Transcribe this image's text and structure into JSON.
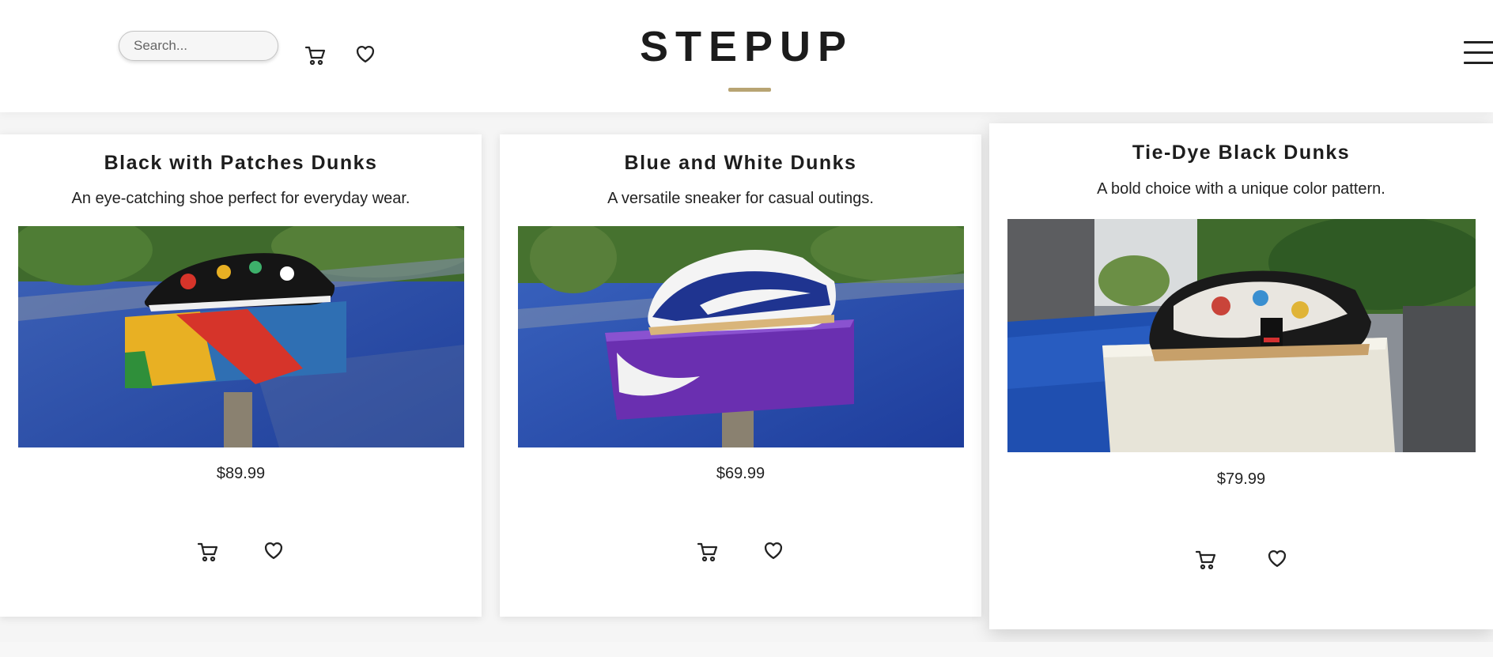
{
  "header": {
    "search_placeholder": "Search...",
    "logo": "STEPUP",
    "accent_color": "#b8a473",
    "icons": [
      "cart-icon",
      "heart-icon",
      "hamburger-menu-icon"
    ]
  },
  "products": [
    {
      "title": "Black with Patches Dunks",
      "description": "An eye-catching shoe perfect for everyday wear.",
      "price": "$89.99",
      "image": "black sneaker with colorful patches on a rainbow shoebox by a pool"
    },
    {
      "title": "Blue and White Dunks",
      "description": "A versatile sneaker for casual outings.",
      "price": "$69.99",
      "image": "blue and white sneaker on a purple shoebox by a pool"
    },
    {
      "title": "Tie-Dye Black Dunks",
      "description": "A bold choice with a unique color pattern.",
      "price": "$79.99",
      "image": "black and patterned sneaker on a white shoebox by a pool"
    }
  ]
}
